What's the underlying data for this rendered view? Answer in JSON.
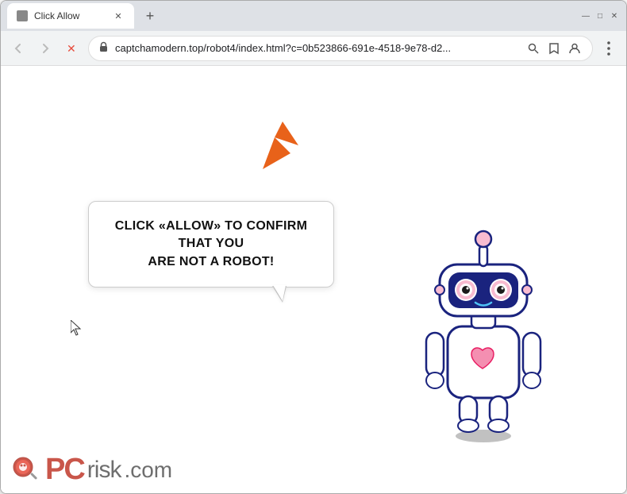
{
  "browser": {
    "tab": {
      "title": "Click Allow",
      "favicon": "⚠"
    },
    "new_tab_label": "+",
    "window_controls": {
      "minimize": "—",
      "maximize": "□",
      "close": "✕"
    },
    "nav": {
      "back_label": "‹",
      "forward_label": "›",
      "reload_label": "✕",
      "address": "captchamodern.top/robot4/index.html?c=0b523866-691e-4518-9e78-d2...",
      "shield_icon": "🛡",
      "search_icon": "🔍",
      "bookmark_icon": "☆",
      "profile_icon": "👤",
      "menu_icon": "⋮"
    }
  },
  "page": {
    "bubble_line1": "CLICK «ALLOW» TO CONFIRM THAT YOU",
    "bubble_line2": "ARE NOT A ROBOT!",
    "arrow_color": "#e8621a"
  },
  "watermark": {
    "site": "PCrisk.com",
    "pc_text": "PC",
    "risk_text": "risk",
    "dot_com": ".com"
  }
}
